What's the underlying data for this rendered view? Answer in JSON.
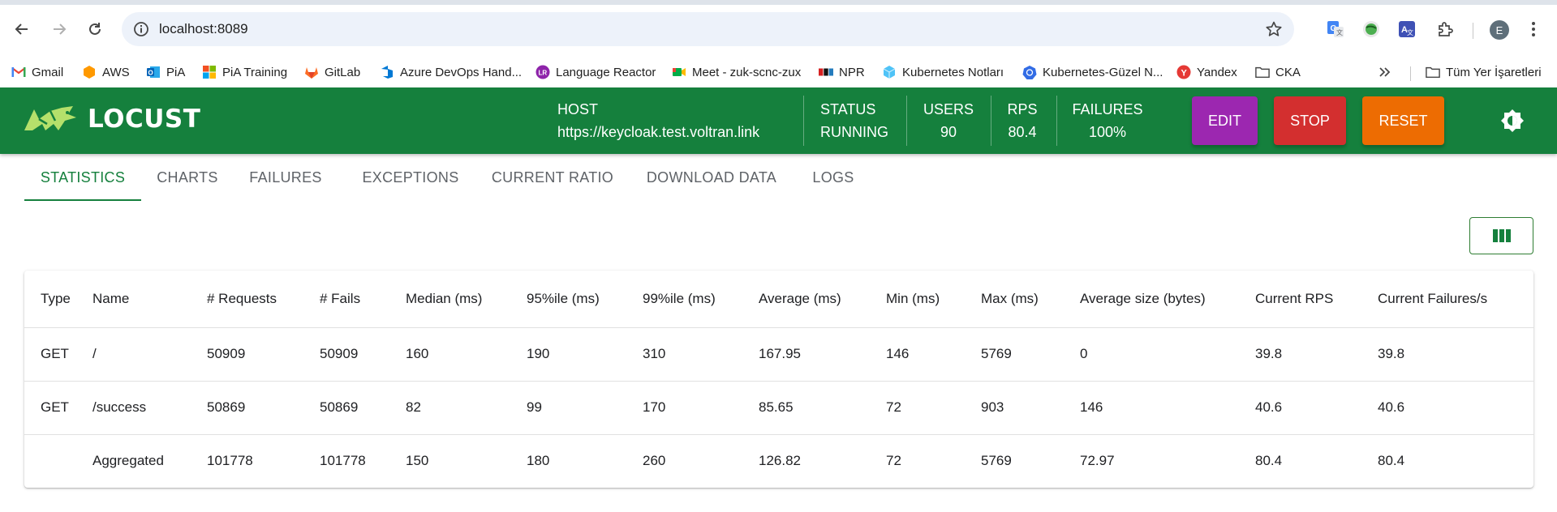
{
  "browser": {
    "url": "localhost:8089",
    "profile_initial": "E",
    "bookmarks": [
      {
        "label": "Gmail",
        "icon": "gmail-icon"
      },
      {
        "label": "AWS",
        "icon": "aws-icon"
      },
      {
        "label": "PiA",
        "icon": "outlook-icon"
      },
      {
        "label": "PiA Training",
        "icon": "microsoft-icon"
      },
      {
        "label": "GitLab",
        "icon": "gitlab-icon"
      },
      {
        "label": "Azure DevOps Hand...",
        "icon": "azure-devops-icon"
      },
      {
        "label": "Language Reactor",
        "icon": "language-reactor-icon"
      },
      {
        "label": "Meet - zuk-scnc-zux",
        "icon": "meet-icon"
      },
      {
        "label": "NPR",
        "icon": "npr-icon"
      },
      {
        "label": "Kubernetes Notları",
        "icon": "cube-icon"
      },
      {
        "label": "Kubernetes-Güzel N...",
        "icon": "kubernetes-icon"
      },
      {
        "label": "Yandex",
        "icon": "yandex-icon"
      },
      {
        "label": "CKA",
        "icon": "folder-icon"
      }
    ],
    "all_bookmarks_label": "Tüm Yer İşaretleri"
  },
  "app": {
    "logo_text": "LOCUST",
    "host_label": "HOST",
    "host_value": "https://keycloak.test.voltran.link",
    "status_label": "STATUS",
    "status_value": "RUNNING",
    "users_label": "USERS",
    "users_value": "90",
    "rps_label": "RPS",
    "rps_value": "80.4",
    "failures_label": "FAILURES",
    "failures_value": "100%",
    "edit_label": "EDIT",
    "stop_label": "STOP",
    "reset_label": "RESET",
    "colors": {
      "header": "#15803d",
      "edit": "#9c27b0",
      "stop": "#d32f2f",
      "reset": "#ed6c02"
    }
  },
  "tabs": [
    "STATISTICS",
    "CHARTS",
    "FAILURES",
    "EXCEPTIONS",
    "CURRENT RATIO",
    "DOWNLOAD DATA",
    "LOGS"
  ],
  "active_tab": "STATISTICS",
  "table": {
    "headers": [
      "Type",
      "Name",
      "# Requests",
      "# Fails",
      "Median (ms)",
      "95%ile (ms)",
      "99%ile (ms)",
      "Average (ms)",
      "Min (ms)",
      "Max (ms)",
      "Average size (bytes)",
      "Current RPS",
      "Current Failures/s"
    ],
    "rows": [
      [
        "GET",
        "/",
        "50909",
        "50909",
        "160",
        "190",
        "310",
        "167.95",
        "146",
        "5769",
        "0",
        "39.8",
        "39.8"
      ],
      [
        "GET",
        "/success",
        "50869",
        "50869",
        "82",
        "99",
        "170",
        "85.65",
        "72",
        "903",
        "146",
        "40.6",
        "40.6"
      ],
      [
        "",
        "Aggregated",
        "101778",
        "101778",
        "150",
        "180",
        "260",
        "126.82",
        "72",
        "5769",
        "72.97",
        "80.4",
        "80.4"
      ]
    ]
  }
}
